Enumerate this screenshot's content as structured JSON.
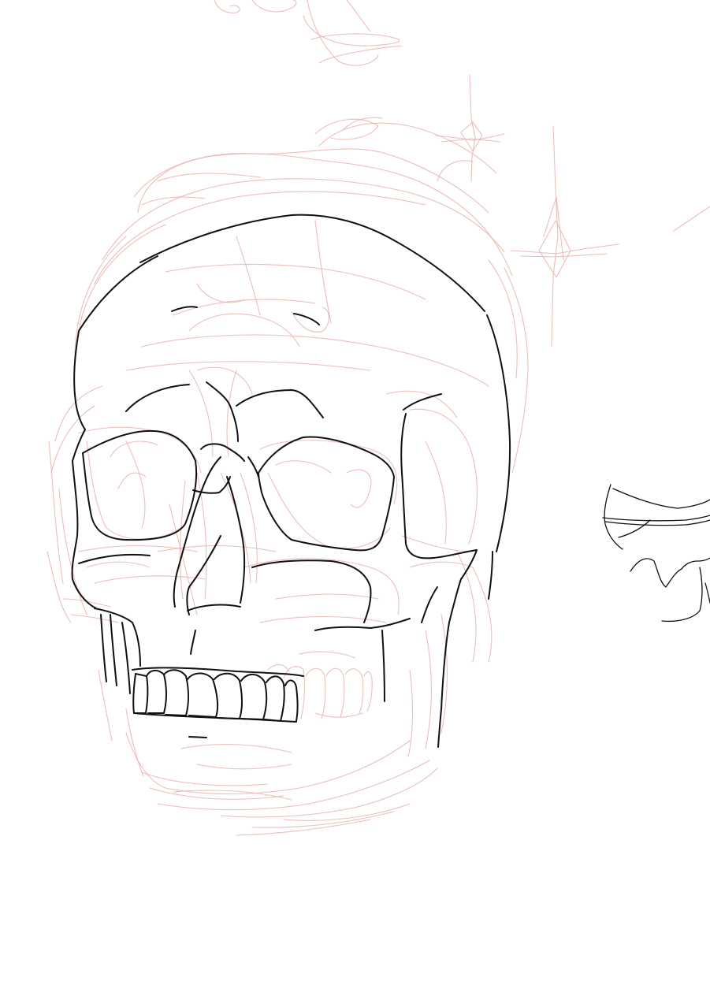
{
  "colors": {
    "background": "#ffffff",
    "sketch": "#e9b3ad",
    "ink": "#111111"
  }
}
